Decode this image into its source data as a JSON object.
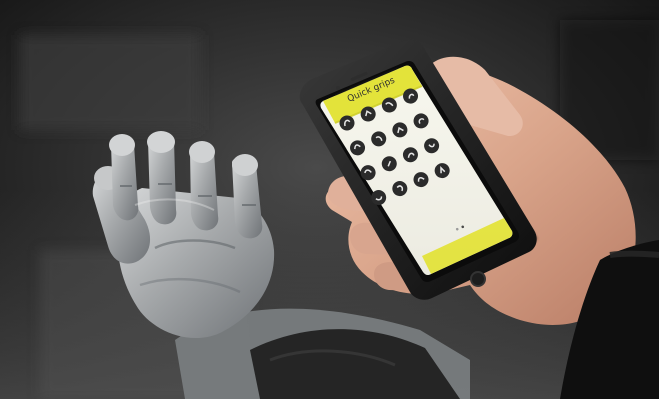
{
  "image": {
    "subject": "prosthetic-hand-and-smartphone-app",
    "colors": {
      "background_dark": "#1b1b1b",
      "background_mid": "#3a3a3a",
      "prosthetic_gray": "#a9acae",
      "skin": "#d9a48a",
      "phone_body": "#141414",
      "app_yellow": "#e3e33a",
      "app_white": "#f6f6ee"
    }
  },
  "phone_app": {
    "title": "Quick grips",
    "grip_icon_count": 16,
    "icon_names": [
      "grip-icon",
      "grip-icon",
      "grip-icon",
      "grip-icon",
      "grip-icon",
      "grip-icon",
      "grip-icon",
      "grip-icon",
      "grip-icon",
      "grip-icon",
      "grip-icon",
      "grip-icon",
      "grip-icon",
      "grip-icon",
      "grip-icon",
      "grip-icon"
    ]
  }
}
